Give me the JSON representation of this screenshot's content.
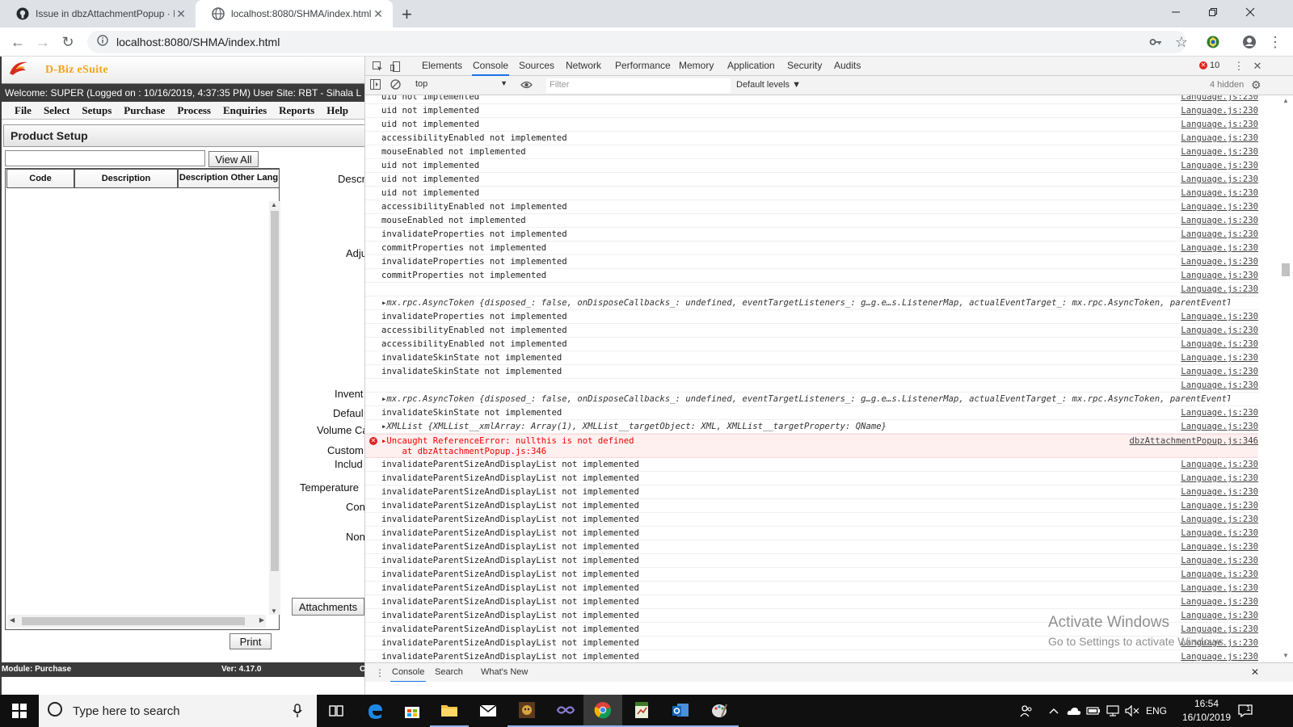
{
  "browser": {
    "tabs": [
      {
        "title": "Issue in dbzAttachmentPopup · Is",
        "active": false,
        "icon": "github-icon"
      },
      {
        "title": "localhost:8080/SHMA/index.html",
        "active": true,
        "icon": "globe-icon"
      }
    ],
    "url": "localhost:8080/SHMA/index.html"
  },
  "app": {
    "logo": "D-Biz eSuite",
    "welcome": "Welcome: SUPER (Logged on : 10/16/2019, 4:37:35 PM) User Site: RBT - Sihala L",
    "menu": [
      "File",
      "Select",
      "Setups",
      "Purchase",
      "Process",
      "Enquiries",
      "Reports",
      "Help"
    ],
    "panel_title": "Product Setup",
    "view_all": "View All",
    "grid_headers": [
      "Code",
      "Description",
      "Description Other Lang"
    ],
    "form_labels": [
      "Descr",
      "Adju",
      "Invent",
      "Defaul",
      "Volume Ca",
      "Custom",
      "Includ",
      "Temperature",
      "Con",
      "Non"
    ],
    "attachments_button": "Attachments",
    "print_button": "Print",
    "status_module": "Module: Purchase",
    "status_version": "Ver: 4.17.0",
    "status_extra": "C"
  },
  "devtools": {
    "tabs": [
      "Elements",
      "Console",
      "Sources",
      "Network",
      "Performance",
      "Memory",
      "Application",
      "Security",
      "Audits"
    ],
    "active_tab": "Console",
    "error_count": "10",
    "context": "top",
    "filter_placeholder": "Filter",
    "levels": "Default levels ▼",
    "hidden": "4 hidden",
    "drawer_tabs": [
      "Console",
      "Search",
      "What's New"
    ],
    "log_rows": [
      {
        "text": "uid not implemented",
        "src": "Language.js:230",
        "kind": "log"
      },
      {
        "text": "uid not implemented",
        "src": "Language.js:230",
        "kind": "log"
      },
      {
        "text": "uid not implemented",
        "src": "Language.js:230",
        "kind": "log"
      },
      {
        "text": "accessibilityEnabled not implemented",
        "src": "Language.js:230",
        "kind": "log"
      },
      {
        "text": "mouseEnabled not implemented",
        "src": "Language.js:230",
        "kind": "log"
      },
      {
        "text": "uid not implemented",
        "src": "Language.js:230",
        "kind": "log"
      },
      {
        "text": "uid not implemented",
        "src": "Language.js:230",
        "kind": "log"
      },
      {
        "text": "uid not implemented",
        "src": "Language.js:230",
        "kind": "log"
      },
      {
        "text": "accessibilityEnabled not implemented",
        "src": "Language.js:230",
        "kind": "log"
      },
      {
        "text": "mouseEnabled not implemented",
        "src": "Language.js:230",
        "kind": "log"
      },
      {
        "text": "invalidateProperties not implemented",
        "src": "Language.js:230",
        "kind": "log"
      },
      {
        "text": "commitProperties not implemented",
        "src": "Language.js:230",
        "kind": "log"
      },
      {
        "text": "invalidateProperties not implemented",
        "src": "Language.js:230",
        "kind": "log"
      },
      {
        "text": "commitProperties not implemented",
        "src": "Language.js:230",
        "kind": "log"
      },
      {
        "text": "",
        "src": "Language.js:230",
        "kind": "log"
      },
      {
        "text": "▸mx.rpc.AsyncToken {disposed_: false, onDisposeCallbacks_: undefined, eventTargetListeners_: g…g.e…s.ListenerMap, actualEventTarget_: mx.rpc.AsyncToken, parentEventTarget_: null, …}",
        "src": "",
        "kind": "obj"
      },
      {
        "text": "invalidateProperties not implemented",
        "src": "Language.js:230",
        "kind": "log"
      },
      {
        "text": "accessibilityEnabled not implemented",
        "src": "Language.js:230",
        "kind": "log"
      },
      {
        "text": "accessibilityEnabled not implemented",
        "src": "Language.js:230",
        "kind": "log"
      },
      {
        "text": "invalidateSkinState not implemented",
        "src": "Language.js:230",
        "kind": "log"
      },
      {
        "text": "invalidateSkinState not implemented",
        "src": "Language.js:230",
        "kind": "log"
      },
      {
        "text": "",
        "src": "Language.js:230",
        "kind": "log"
      },
      {
        "text": "▸mx.rpc.AsyncToken {disposed_: false, onDisposeCallbacks_: undefined, eventTargetListeners_: g…g.e…s.ListenerMap, actualEventTarget_: mx.rpc.AsyncToken, parentEventTarget_: null, …}",
        "src": "",
        "kind": "obj"
      },
      {
        "text": "invalidateSkinState not implemented",
        "src": "Language.js:230",
        "kind": "log"
      },
      {
        "text": "▸XMLList {XMLList__xmlArray: Array(1), XMLList__targetObject: XML, XMLList__targetProperty: QName}",
        "src": "Language.js:230",
        "kind": "obj"
      },
      {
        "text": "▸Uncaught ReferenceError: nullthis is not defined",
        "text2": "    at dbzAttachmentPopup.js:346",
        "src": "dbzAttachmentPopup.js:346",
        "kind": "err"
      },
      {
        "text": "invalidateParentSizeAndDisplayList not implemented",
        "src": "Language.js:230",
        "kind": "log"
      },
      {
        "text": "invalidateParentSizeAndDisplayList not implemented",
        "src": "Language.js:230",
        "kind": "log"
      },
      {
        "text": "invalidateParentSizeAndDisplayList not implemented",
        "src": "Language.js:230",
        "kind": "log"
      },
      {
        "text": "invalidateParentSizeAndDisplayList not implemented",
        "src": "Language.js:230",
        "kind": "log"
      },
      {
        "text": "invalidateParentSizeAndDisplayList not implemented",
        "src": "Language.js:230",
        "kind": "log"
      },
      {
        "text": "invalidateParentSizeAndDisplayList not implemented",
        "src": "Language.js:230",
        "kind": "log"
      },
      {
        "text": "invalidateParentSizeAndDisplayList not implemented",
        "src": "Language.js:230",
        "kind": "log"
      },
      {
        "text": "invalidateParentSizeAndDisplayList not implemented",
        "src": "Language.js:230",
        "kind": "log"
      },
      {
        "text": "invalidateParentSizeAndDisplayList not implemented",
        "src": "Language.js:230",
        "kind": "log"
      },
      {
        "text": "invalidateParentSizeAndDisplayList not implemented",
        "src": "Language.js:230",
        "kind": "log"
      },
      {
        "text": "invalidateParentSizeAndDisplayList not implemented",
        "src": "Language.js:230",
        "kind": "log"
      },
      {
        "text": "invalidateParentSizeAndDisplayList not implemented",
        "src": "Language.js:230",
        "kind": "log"
      },
      {
        "text": "invalidateParentSizeAndDisplayList not implemented",
        "src": "Language.js:230",
        "kind": "log"
      },
      {
        "text": "invalidateParentSizeAndDisplayList not implemented",
        "src": "Language.js:230",
        "kind": "log"
      },
      {
        "text": "invalidateParentSizeAndDisplayList not implemented",
        "src": "Language.js:230",
        "kind": "log"
      }
    ]
  },
  "watermark": {
    "line1": "Activate Windows",
    "line2": "Go to Settings to activate Windows."
  },
  "taskbar": {
    "search_placeholder": "Type here to search",
    "apps": [
      "task-view-icon",
      "edge-icon",
      "store-icon",
      "file-explorer-icon",
      "mail-icon",
      "game-icon",
      "visual-studio-icon",
      "chrome-icon",
      "spreadsheet-icon",
      "outlook-icon",
      "paint-icon"
    ],
    "language": "ENG",
    "time": "16:54",
    "date": "16/10/2019",
    "notification_count": "1"
  }
}
